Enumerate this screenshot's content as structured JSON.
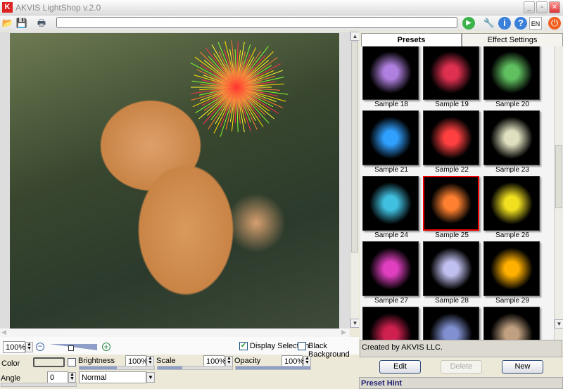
{
  "window": {
    "title": "AKVIS LightShop v.2.0"
  },
  "toolbar": {
    "language": "EN",
    "path": ""
  },
  "view": {
    "zoom": "100%",
    "display_selection": "Display Selection",
    "black_background": "Black Background",
    "display_selection_checked": true,
    "black_background_checked": false,
    "zoom_slider": 0.45
  },
  "settings": {
    "color_label": "Color",
    "brightness_label": "Brightness",
    "brightness_value": "100%",
    "brightness_fraction": 0.5,
    "scale_label": "Scale",
    "scale_value": "100%",
    "scale_fraction": 0.33,
    "opacity_label": "Opacity",
    "opacity_value": "100%",
    "opacity_fraction": 1.0,
    "angle_label": "Angle",
    "angle_value": "0",
    "blend_mode": "Normal"
  },
  "tabs": {
    "presets": "Presets",
    "effect_settings": "Effect Settings"
  },
  "presets": [
    {
      "name": "Sample 18",
      "color": "#b080e0"
    },
    {
      "name": "Sample 19",
      "color": "#e03050"
    },
    {
      "name": "Sample 20",
      "color": "#60c060"
    },
    {
      "name": "Sample 21",
      "color": "#30a0ff"
    },
    {
      "name": "Sample 22",
      "color": "#ff4040"
    },
    {
      "name": "Sample 23",
      "color": "#e0e0c0"
    },
    {
      "name": "Sample 24",
      "color": "#40c0e0"
    },
    {
      "name": "Sample 25",
      "color": "#ff8030"
    },
    {
      "name": "Sample 26",
      "color": "#f0e020"
    },
    {
      "name": "Sample 27",
      "color": "#e040c0"
    },
    {
      "name": "Sample 28",
      "color": "#c0c0f0"
    },
    {
      "name": "Sample 29",
      "color": "#ffb000"
    },
    {
      "name": "",
      "color": "#d02050"
    },
    {
      "name": "",
      "color": "#8090d0"
    },
    {
      "name": "",
      "color": "#c0a080"
    }
  ],
  "selected_preset": "Sample 25",
  "preset_info": "Created by AKVIS LLC.",
  "buttons": {
    "edit": "Edit",
    "delete": "Delete",
    "new": "New"
  },
  "hint": {
    "title": "Preset Hint"
  }
}
